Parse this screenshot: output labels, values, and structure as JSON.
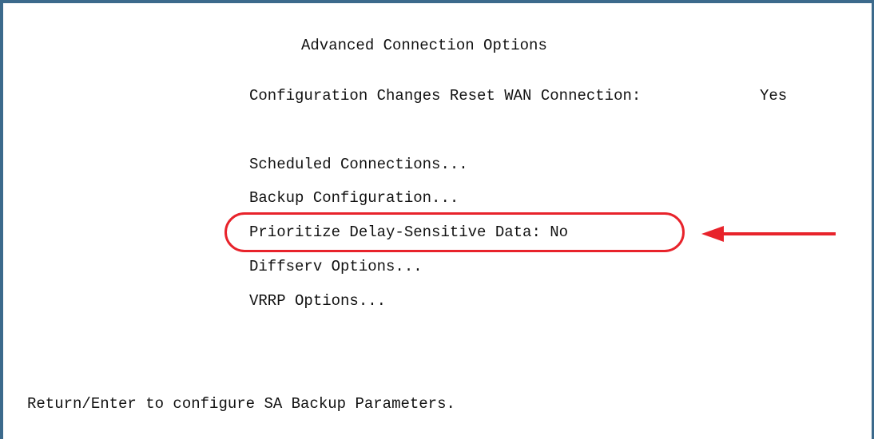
{
  "screen": {
    "title": "Advanced Connection Options",
    "reset_setting": {
      "label": "Configuration Changes Reset WAN Connection:",
      "value": "Yes"
    },
    "menu": [
      {
        "label": "Scheduled Connections..."
      },
      {
        "label": "Backup Configuration..."
      },
      {
        "label": "Prioritize Delay-Sensitive Data: No"
      },
      {
        "label": "Diffserv Options..."
      },
      {
        "label": "VRRP Options..."
      }
    ],
    "status_line": "Return/Enter to configure SA Backup Parameters."
  },
  "annotation": {
    "color": "#e8232b",
    "ring_icon": "highlight-ring",
    "arrow_icon": "arrow-left-icon"
  },
  "colors": {
    "frame_border": "#3c6a8c",
    "text": "#111111",
    "background": "#ffffff"
  }
}
